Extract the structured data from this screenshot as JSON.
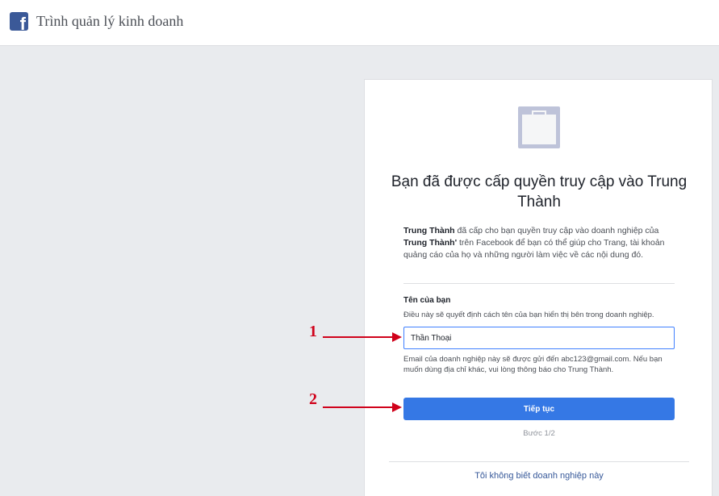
{
  "header": {
    "logo_letter": "f",
    "title": "Trình quản lý kinh doanh"
  },
  "card": {
    "icon": "briefcase-icon",
    "heading": "Bạn đã được cấp quyền truy cập vào Trung Thành",
    "description": {
      "part1_bold": "Trung Thành",
      "part2": " đã cấp cho bạn quyền truy cập vào doanh nghiệp của ",
      "part3_bold": "Trung Thành'",
      "part4": " trên Facebook để bạn có thể giúp cho Trang, tài khoản quảng cáo của họ và những người làm việc về các nội dung đó."
    },
    "name_field": {
      "label": "Tên của bạn",
      "hint": "Điều này sẽ quyết định cách tên của bạn hiển thị bên trong doanh nghiệp.",
      "value": "Thần Thoại"
    },
    "email_note": "Email của doanh nghiệp này sẽ được gửi đến abc123@gmail.com. Nếu bạn muốn dùng địa chỉ khác, vui lòng thông báo cho Trung Thành.",
    "continue_label": "Tiếp tục",
    "step_text": "Bước 1/2",
    "unknown_business_link": "Tôi không biết doanh nghiệp này"
  },
  "annotations": [
    {
      "number": "1"
    },
    {
      "number": "2"
    }
  ],
  "colors": {
    "accent": "#3578e5",
    "annotation": "#d0021b",
    "facebook_blue": "#3b5998"
  }
}
